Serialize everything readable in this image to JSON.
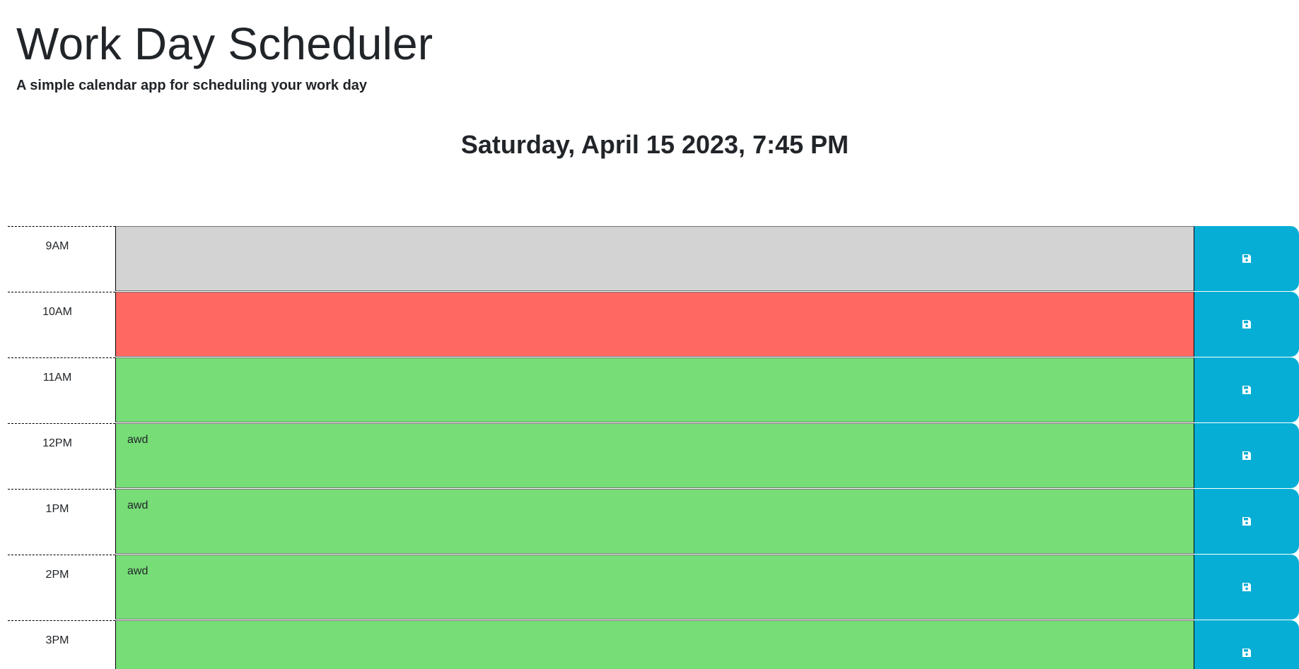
{
  "header": {
    "title": "Work Day Scheduler",
    "lead": "A simple calendar app for scheduling your work day",
    "current_day": "Saturday, April 15 2023, 7:45 PM"
  },
  "colors": {
    "past": "#d3d3d3",
    "present": "#ff6961",
    "future": "#77dd77",
    "save_button": "#06aed5"
  },
  "save_icon": "floppy-disk-icon",
  "time_blocks": [
    {
      "hour": "9AM",
      "text": "",
      "state": "past"
    },
    {
      "hour": "10AM",
      "text": "",
      "state": "present"
    },
    {
      "hour": "11AM",
      "text": "",
      "state": "future"
    },
    {
      "hour": "12PM",
      "text": "awd",
      "state": "future"
    },
    {
      "hour": "1PM",
      "text": "awd",
      "state": "future"
    },
    {
      "hour": "2PM",
      "text": "awd",
      "state": "future"
    },
    {
      "hour": "3PM",
      "text": "",
      "state": "future"
    }
  ]
}
